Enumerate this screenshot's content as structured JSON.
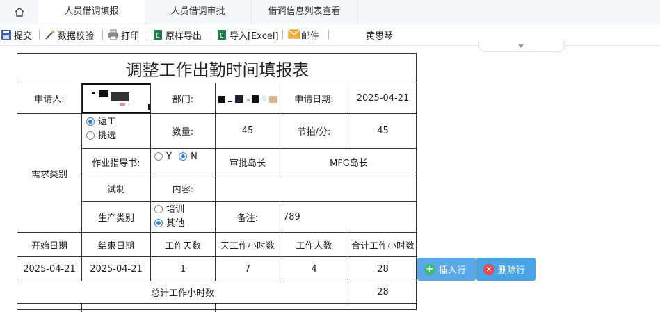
{
  "tabs": [
    {
      "label": "人员借调填报",
      "active": true
    },
    {
      "label": "人员借调审批",
      "active": false
    },
    {
      "label": "借调信息列表查看",
      "active": false
    }
  ],
  "toolbar": {
    "submit": "提交",
    "validate": "数据校验",
    "print": "打印",
    "export": "原样导出",
    "import": "导入[Excel]",
    "mail": "邮件",
    "user": "黄思琴"
  },
  "form": {
    "title": "调整工作出勤时间填报表",
    "applicant_label": "申请人:",
    "dept_label": "部门:",
    "apply_date_label": "申请日期:",
    "apply_date": "2025-04-21",
    "demand_type_label": "需求类别",
    "demand_options": [
      {
        "label": "返工",
        "checked": true
      },
      {
        "label": "挑选",
        "checked": false
      }
    ],
    "qty_label": "数量:",
    "qty": "45",
    "takt_label": "节拍/分:",
    "takt": "45",
    "sop_label": "作业指导书:",
    "sop_options": [
      {
        "label": "Y",
        "checked": false
      },
      {
        "label": "N",
        "checked": true
      }
    ],
    "approver_label": "审批岛长",
    "approver": "MFG岛长",
    "trial_label": "试制",
    "content_label": "内容:",
    "content": "",
    "prod_type_label": "生产类别",
    "prod_options": [
      {
        "label": "培训",
        "checked": false
      },
      {
        "label": "其他",
        "checked": true
      }
    ],
    "remark_label": "备注:",
    "remark": "789",
    "headers": [
      "开始日期",
      "结束日期",
      "工作天数",
      "天工作小时数",
      "工作人数",
      "合计工作小时数"
    ],
    "row": [
      "2025-04-21",
      "2025-04-21",
      "1",
      "7",
      "4",
      "28"
    ],
    "total_label": "总计工作小时数",
    "total": "28"
  },
  "buttons": {
    "insert": "插入行",
    "delete": "删除行"
  },
  "colors": {
    "accent": "#2f7fe0",
    "button": "#5aa8e8",
    "delete_icon": "#e8474b",
    "insert_icon": "#3dbb6a"
  }
}
